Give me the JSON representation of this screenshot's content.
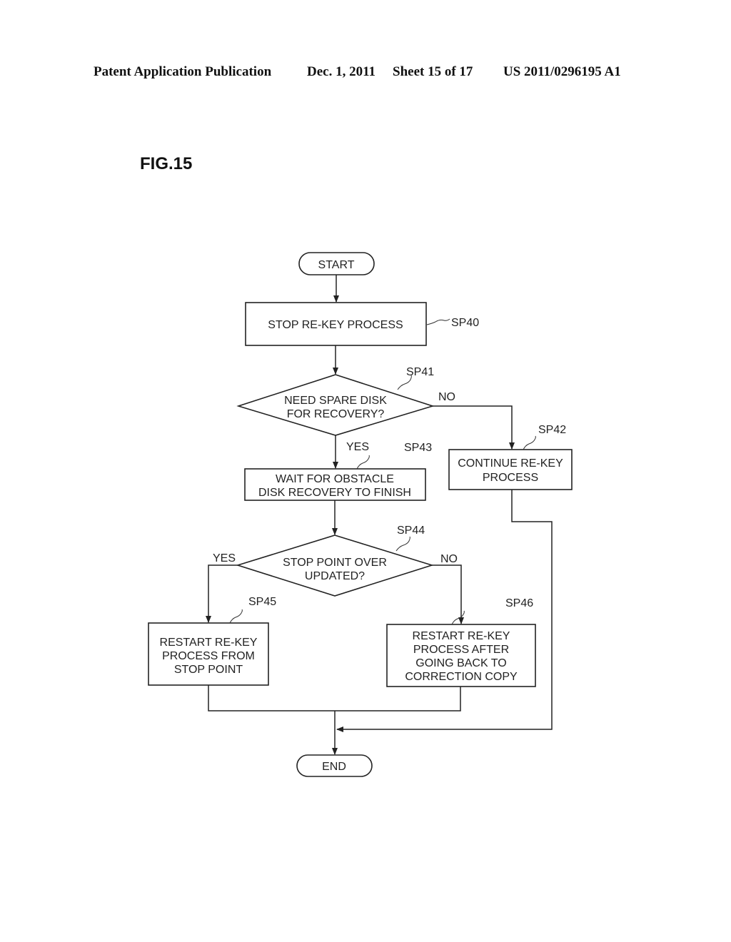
{
  "header": {
    "publication": "Patent Application Publication",
    "date": "Dec. 1, 2011",
    "sheet": "Sheet 15 of 17",
    "number": "US 2011/0296195 A1"
  },
  "figure_label": "FIG.15",
  "flowchart": {
    "start": "START",
    "end": "END",
    "sp40": {
      "ref": "SP40",
      "lines": [
        "STOP RE-KEY PROCESS"
      ]
    },
    "sp41": {
      "ref": "SP41",
      "lines": [
        "NEED SPARE DISK",
        "FOR RECOVERY?"
      ],
      "yes": "YES",
      "no": "NO"
    },
    "sp42": {
      "ref": "SP42",
      "lines": [
        "CONTINUE RE-KEY",
        "PROCESS"
      ]
    },
    "sp43": {
      "ref": "SP43",
      "lines": [
        "WAIT FOR OBSTACLE",
        "DISK RECOVERY TO FINISH"
      ]
    },
    "sp44": {
      "ref": "SP44",
      "lines": [
        "STOP POINT OVER",
        "UPDATED?"
      ],
      "yes": "YES",
      "no": "NO"
    },
    "sp45": {
      "ref": "SP45",
      "lines": [
        "RESTART RE-KEY",
        "PROCESS FROM",
        "STOP POINT"
      ]
    },
    "sp46": {
      "ref": "SP46",
      "lines": [
        "RESTART RE-KEY",
        "PROCESS AFTER",
        "GOING BACK TO",
        "CORRECTION COPY"
      ]
    }
  }
}
